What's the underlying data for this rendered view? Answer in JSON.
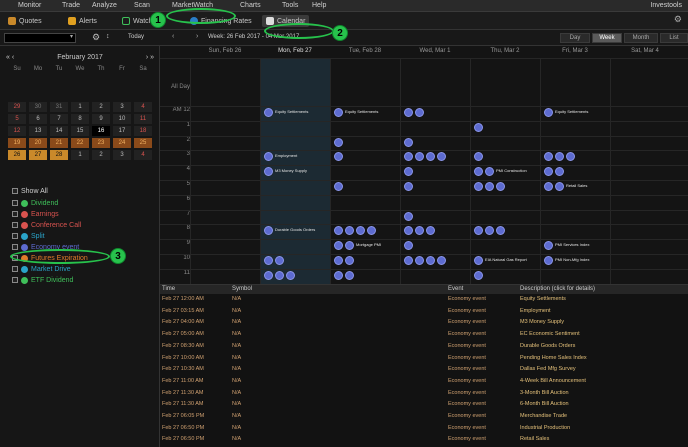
{
  "menu": {
    "items": [
      {
        "label": "Monitor"
      },
      {
        "label": "Trade"
      },
      {
        "label": "Analyze"
      },
      {
        "label": "Scan"
      },
      {
        "label": "MarketWatch"
      },
      {
        "label": "Charts"
      },
      {
        "label": "Tools"
      },
      {
        "label": "Help"
      }
    ],
    "right_label": "Investools"
  },
  "tabs": {
    "items": [
      {
        "label": "Quotes",
        "icon": "quotes-icon"
      },
      {
        "label": "Alerts",
        "icon": "alerts-icon"
      },
      {
        "label": "Watch",
        "icon": "watch-icon"
      },
      {
        "label": "Financing Rates",
        "icon": "rates-icon"
      },
      {
        "label": "Calendar",
        "icon": "calendar-icon"
      }
    ]
  },
  "toolbar": {
    "today_label": "Today",
    "range_label": "Week: 26 Feb 2017 - 04 Mar 2017",
    "views": [
      "Day",
      "Week",
      "Month",
      "List"
    ],
    "active_view": "Week"
  },
  "mini_calendar": {
    "title": "February 2017",
    "dow": [
      "Su",
      "Mo",
      "Tu",
      "We",
      "Th",
      "Fr",
      "Sa"
    ],
    "weeks": [
      [
        "29",
        "30",
        "31",
        "1",
        "2",
        "3",
        "4"
      ],
      [
        "5",
        "6",
        "7",
        "8",
        "9",
        "10",
        "11"
      ],
      [
        "12",
        "13",
        "14",
        "15",
        "16",
        "17",
        "18"
      ],
      [
        "19",
        "20",
        "21",
        "22",
        "23",
        "24",
        "25"
      ],
      [
        "26",
        "27",
        "28",
        "1",
        "2",
        "3",
        "4"
      ]
    ]
  },
  "filters": {
    "show_all": "Show All",
    "items": [
      {
        "label": "Dividend",
        "color": "#3fbf5a"
      },
      {
        "label": "Earnings",
        "color": "#d9534f"
      },
      {
        "label": "Conference Call",
        "color": "#d9534f"
      },
      {
        "label": "Split",
        "color": "#2aa3c8"
      },
      {
        "label": "Economy event",
        "color": "#5d6bd0"
      },
      {
        "label": "Futures Expiration",
        "color": "#e07b2a"
      },
      {
        "label": "Market Drive",
        "color": "#2aa3c8"
      },
      {
        "label": "ETF Dividend",
        "color": "#3fbf5a"
      }
    ]
  },
  "week": {
    "all_day": "All Day",
    "days": [
      "Sun, Feb 26",
      "Mon, Feb 27",
      "Tue, Feb 28",
      "Wed, Mar 1",
      "Thu, Mar 2",
      "Fri, Mar 3",
      "Sat, Mar 4"
    ],
    "hours": [
      "AM 12",
      "1",
      "2",
      "3",
      "4",
      "5",
      "6",
      "7",
      "8",
      "9",
      "10",
      "11"
    ],
    "event_labels": [
      "Equity Settlements",
      "Equity Settlements",
      "Equity Settlements",
      "Employment",
      "M3 Money Supply",
      "PMI Construction",
      "Retail Sales",
      "Durable Goods Orders",
      "Mortgage PMI",
      "PMI Services Index",
      "PMI Manufacturing",
      "EIA Natural Gas Report",
      "PMI Non-Mfg Index"
    ]
  },
  "list": {
    "columns": [
      "Time",
      "Symbol",
      "Event",
      "Description (click for details)"
    ],
    "rows": [
      {
        "time": "Feb 27 12:00 AM",
        "symbol": "N/A",
        "event": "Economy event",
        "desc": "Equity Settlements"
      },
      {
        "time": "Feb 27 03:15 AM",
        "symbol": "N/A",
        "event": "Economy event",
        "desc": "Employment"
      },
      {
        "time": "Feb 27 04:00 AM",
        "symbol": "N/A",
        "event": "Economy event",
        "desc": "M3 Money Supply"
      },
      {
        "time": "Feb 27 05:00 AM",
        "symbol": "N/A",
        "event": "Economy event",
        "desc": "EC Economic Sentiment"
      },
      {
        "time": "Feb 27 08:30 AM",
        "symbol": "N/A",
        "event": "Economy event",
        "desc": "Durable Goods Orders"
      },
      {
        "time": "Feb 27 10:00 AM",
        "symbol": "N/A",
        "event": "Economy event",
        "desc": "Pending Home Sales Index"
      },
      {
        "time": "Feb 27 10:30 AM",
        "symbol": "N/A",
        "event": "Economy event",
        "desc": "Dallas Fed Mfg Survey"
      },
      {
        "time": "Feb 27 11:00 AM",
        "symbol": "N/A",
        "event": "Economy event",
        "desc": "4-Week Bill Announcement"
      },
      {
        "time": "Feb 27 11:30 AM",
        "symbol": "N/A",
        "event": "Economy event",
        "desc": "3-Month Bill Auction"
      },
      {
        "time": "Feb 27 11:30 AM",
        "symbol": "N/A",
        "event": "Economy event",
        "desc": "6-Month Bill Auction"
      },
      {
        "time": "Feb 27 06:05 PM",
        "symbol": "N/A",
        "event": "Economy event",
        "desc": "Merchandise Trade"
      },
      {
        "time": "Feb 27 06:50 PM",
        "symbol": "N/A",
        "event": "Economy event",
        "desc": "Industrial Production"
      },
      {
        "time": "Feb 27 06:50 PM",
        "symbol": "N/A",
        "event": "Economy event",
        "desc": "Retail Sales"
      }
    ]
  },
  "annotations": [
    "1",
    "2",
    "3"
  ]
}
